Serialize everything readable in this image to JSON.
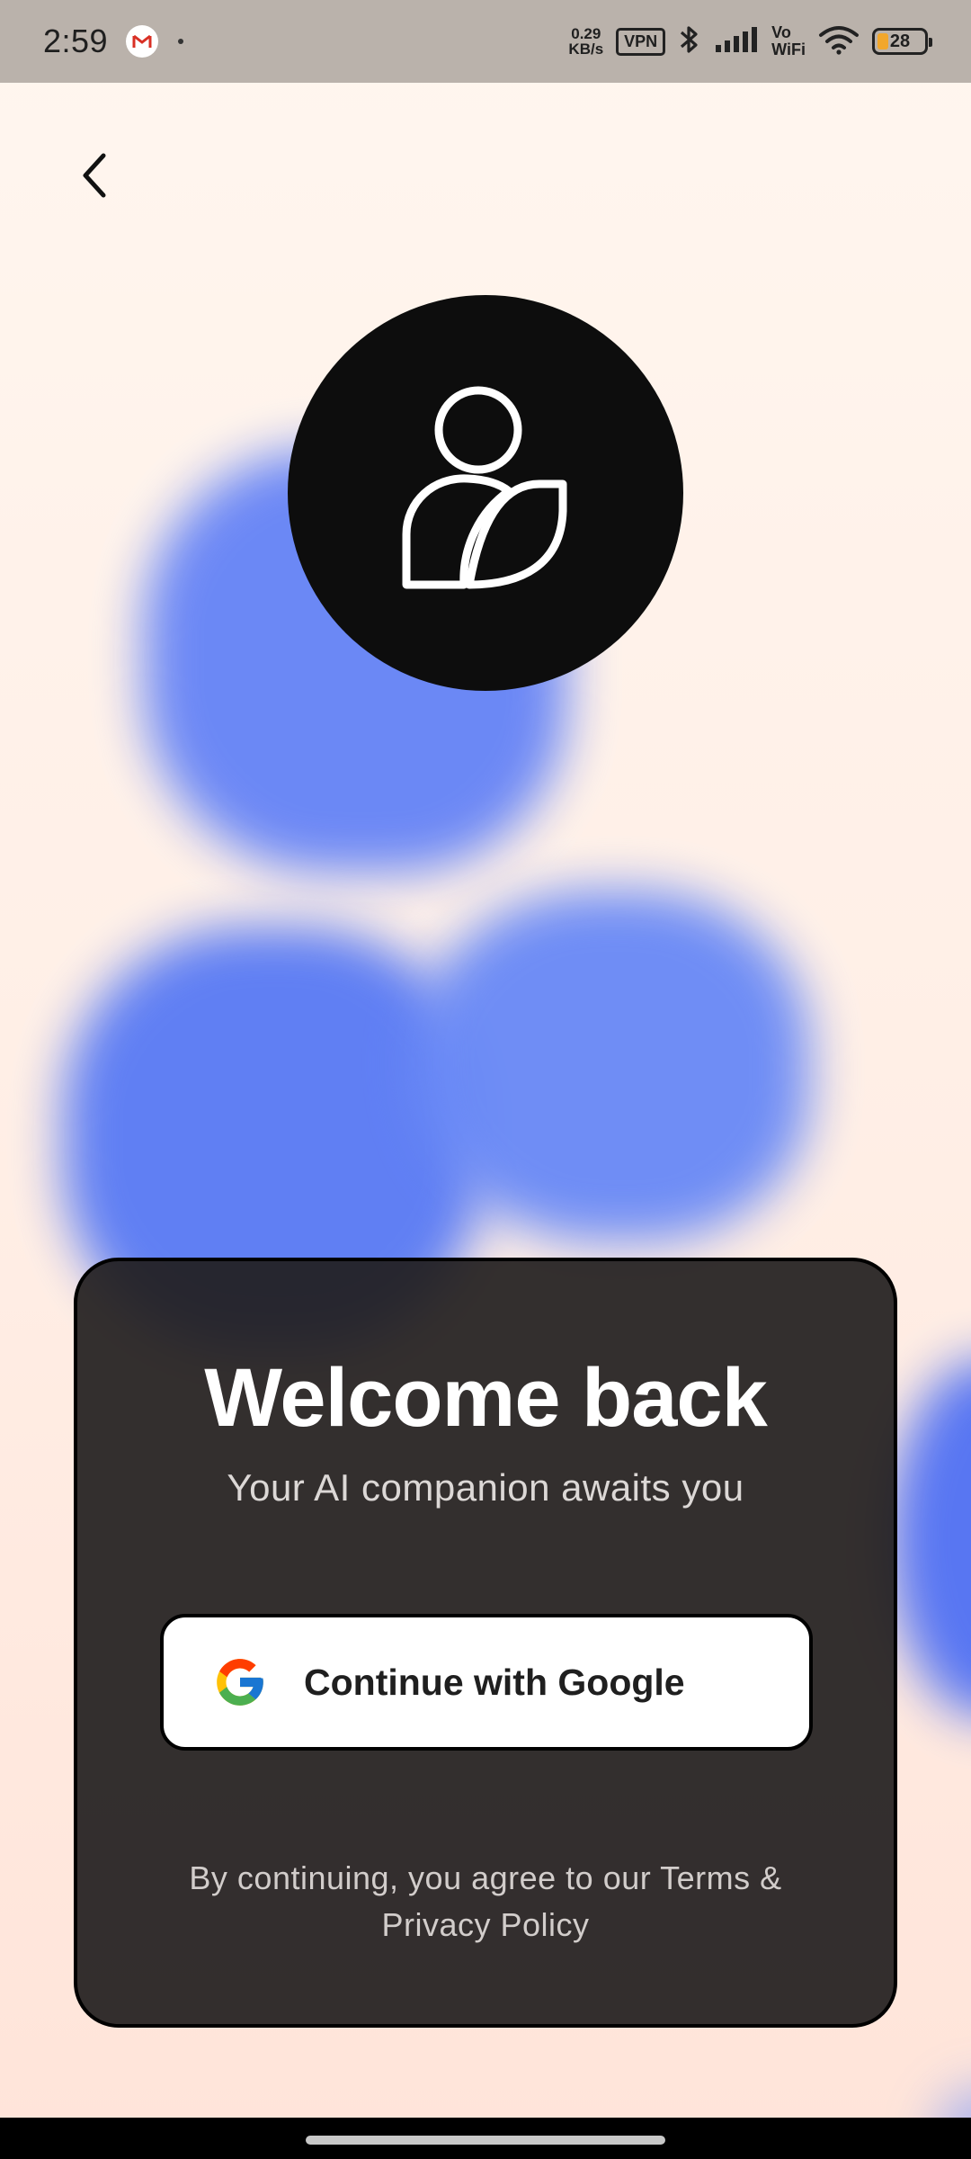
{
  "status_bar": {
    "time": "2:59",
    "net_speed_value": "0.29",
    "net_speed_unit": "KB/s",
    "vpn_label": "VPN",
    "vowifi_top": "Vo",
    "vowifi_bottom": "WiFi",
    "battery_level": "28"
  },
  "icons": {
    "back": "chevron-left-icon",
    "avatar": "person-leaf-icon",
    "google": "google-g-icon"
  },
  "card": {
    "title": "Welcome back",
    "subtitle": "Your AI companion awaits you",
    "google_button_label": "Continue with Google",
    "legal_line1": "By continuing, you agree to our Terms &",
    "legal_line2": "Privacy Policy"
  },
  "colors": {
    "blob_blue": "#5a7cf7",
    "card_bg": "#221e1e",
    "background": "#fff3ec"
  }
}
